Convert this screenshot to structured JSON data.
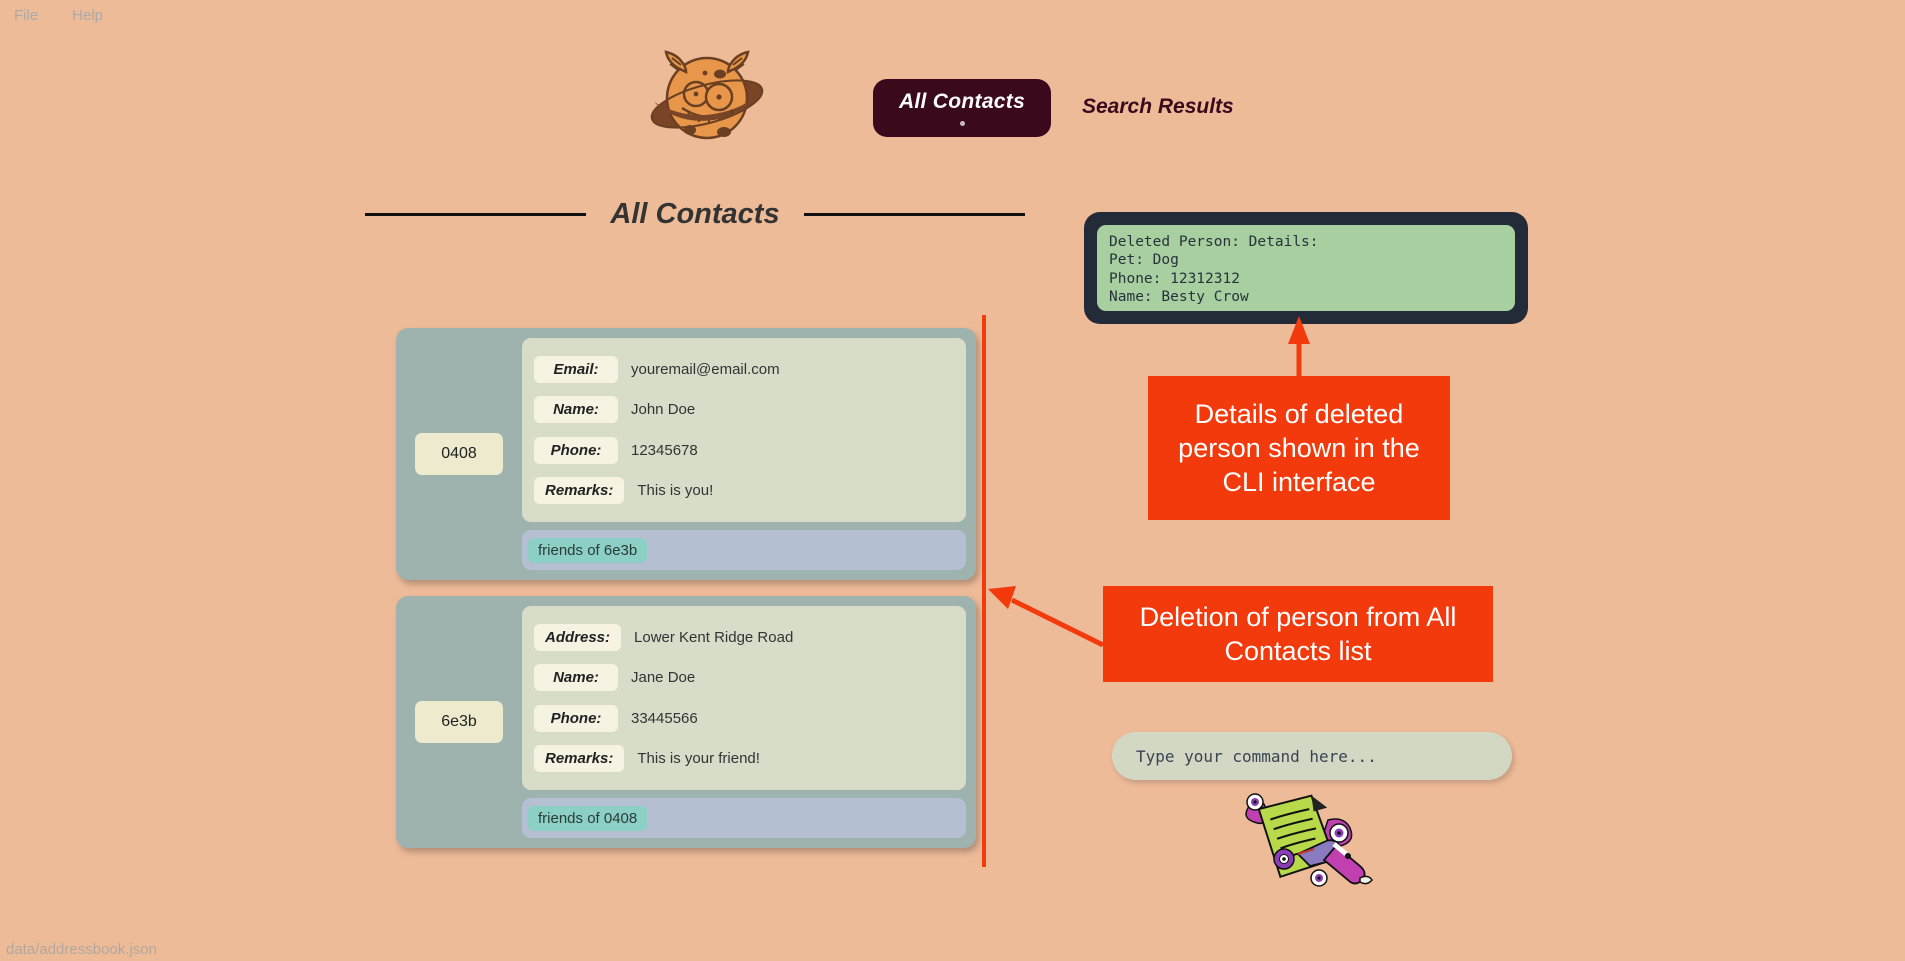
{
  "menubar": {
    "items": [
      {
        "label": "File"
      },
      {
        "label": "Help"
      }
    ]
  },
  "header": {
    "logo_icon": "planet-monster-logo",
    "tabs": [
      {
        "label": "All Contacts",
        "active": true
      },
      {
        "label": "Search Results",
        "active": false
      }
    ]
  },
  "main": {
    "section_title": "All Contacts",
    "contacts": [
      {
        "id": "0408",
        "fields": [
          {
            "key": "Email:",
            "value": "youremail@email.com"
          },
          {
            "key": "Name:",
            "value": "John Doe"
          },
          {
            "key": "Phone:",
            "value": "12345678"
          },
          {
            "key": "Remarks:",
            "value": "This is you!"
          }
        ],
        "tag": "friends of 6e3b"
      },
      {
        "id": "6e3b",
        "fields": [
          {
            "key": "Address:",
            "value": "Lower Kent Ridge Road"
          },
          {
            "key": "Name:",
            "value": "Jane Doe"
          },
          {
            "key": "Phone:",
            "value": "33445566"
          },
          {
            "key": "Remarks:",
            "value": "This is your friend!"
          }
        ],
        "tag": "friends of 0408"
      }
    ]
  },
  "cli": {
    "output": "Deleted Person: Details:\nPet: Dog\nPhone: 12312312\nName: Besty Crow",
    "input_placeholder": "Type your command here...",
    "input_value": ""
  },
  "annotations": [
    {
      "text": "Details of deleted person shown in the CLI interface"
    },
    {
      "text": "Deletion of person from All Contacts list"
    }
  ],
  "statusbar": {
    "path": "data/addressbook.json"
  },
  "colors": {
    "background": "#eebb99",
    "accent_red": "#f23a0c",
    "tab_active": "#3a0a1c",
    "card": "#9fb3ae",
    "fields": "#d8ddca",
    "cli_screen": "#a8cfa0",
    "cli_frame": "#232b39"
  }
}
